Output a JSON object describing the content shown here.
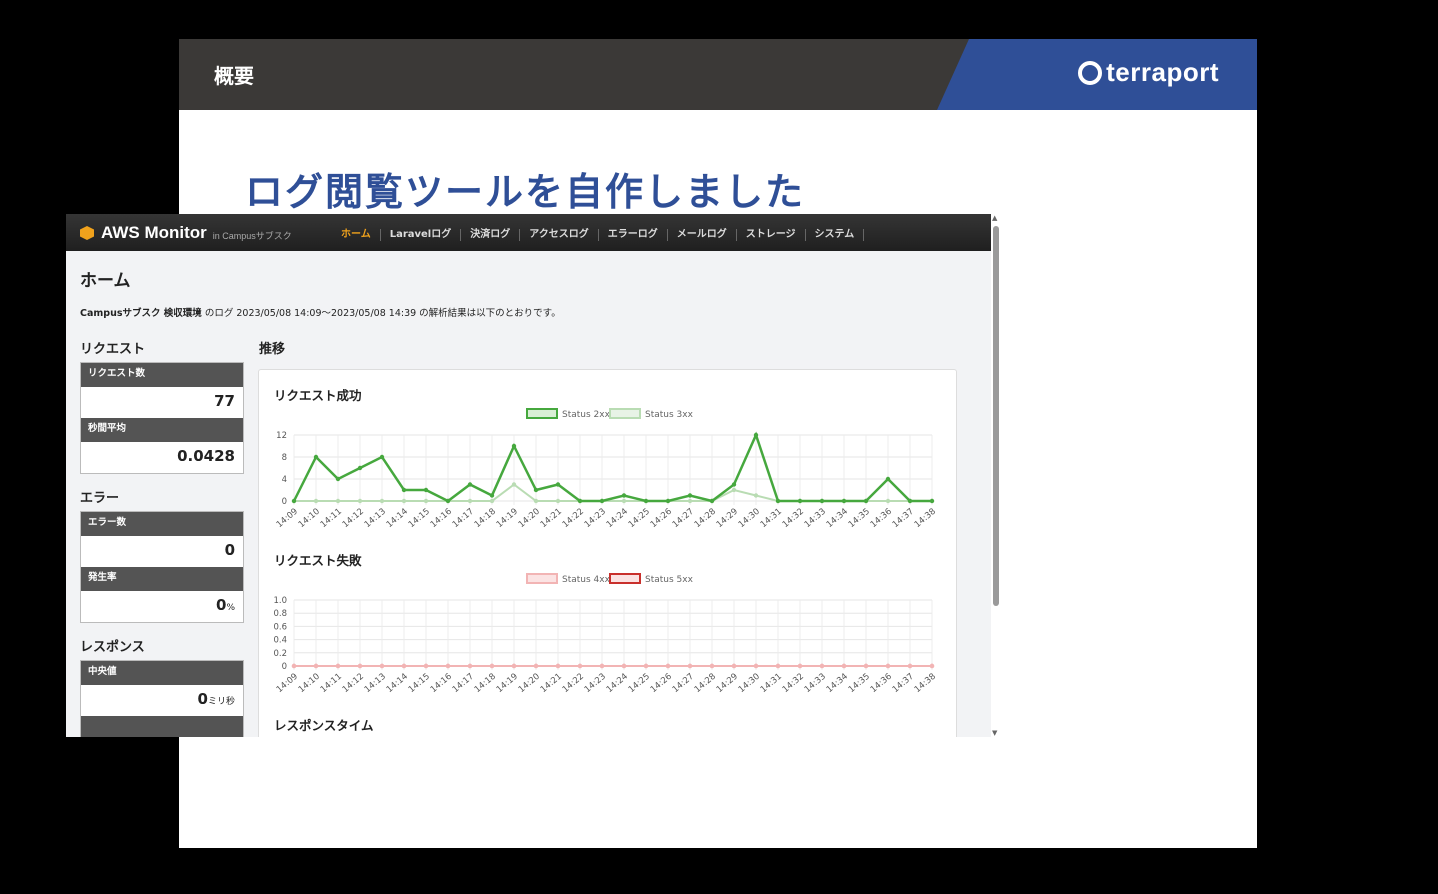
{
  "slide": {
    "section_title": "概要",
    "logo_text": "terraport",
    "headline": "ログ閲覧ツールを自作しました"
  },
  "app": {
    "brand": "AWS Monitor",
    "brand_sub": "in Campusサブスク",
    "nav": [
      "ホーム",
      "Laravelログ",
      "決済ログ",
      "アクセスログ",
      "エラーログ",
      "メールログ",
      "ストレージ",
      "システム"
    ],
    "active_nav": 0,
    "page_title": "ホーム",
    "summary_bold": "Campusサブスク 検収環境",
    "summary_rest": " のログ 2023/05/08 14:09〜2023/05/08 14:39 の解析結果は以下のとおりです。",
    "request": {
      "title": "リクエスト",
      "count_label": "リクエスト数",
      "count": "77",
      "avg_label": "秒間平均",
      "avg": "0.0428"
    },
    "error": {
      "title": "エラー",
      "count_label": "エラー数",
      "count": "0",
      "rate_label": "発生率",
      "rate": "0",
      "rate_unit": "%"
    },
    "response": {
      "title": "レスポンス",
      "median_label": "中央値",
      "median": "0",
      "median_unit": "ミリ秒"
    },
    "trend_title": "推移",
    "chart3_title": "レスポンスタイム"
  },
  "colors": {
    "accent_blue": "#2f4f97",
    "green": "#46a83e",
    "light_green": "#b9dcb3",
    "pink": "#f2b4b4",
    "red": "#c9302c"
  },
  "chart_data": [
    {
      "type": "line",
      "title": "リクエスト成功",
      "categories": [
        "14:09",
        "14:10",
        "14:11",
        "14:12",
        "14:13",
        "14:14",
        "14:15",
        "14:16",
        "14:17",
        "14:18",
        "14:19",
        "14:20",
        "14:21",
        "14:22",
        "14:23",
        "14:24",
        "14:25",
        "14:26",
        "14:27",
        "14:28",
        "14:29",
        "14:30",
        "14:31",
        "14:32",
        "14:33",
        "14:34",
        "14:35",
        "14:36",
        "14:37",
        "14:38"
      ],
      "series": [
        {
          "name": "Status 2xx",
          "values": [
            0,
            8,
            4,
            6,
            8,
            2,
            2,
            0,
            3,
            1,
            10,
            2,
            3,
            0,
            0,
            1,
            0,
            0,
            1,
            0,
            3,
            12,
            0,
            0,
            0,
            0,
            0,
            4,
            0,
            0
          ]
        },
        {
          "name": "Status 3xx",
          "values": [
            0,
            0,
            0,
            0,
            0,
            0,
            0,
            0,
            0,
            0,
            3,
            0,
            0,
            0,
            0,
            0,
            0,
            0,
            0,
            0,
            2,
            1,
            0,
            0,
            0,
            0,
            0,
            0,
            0,
            0
          ]
        }
      ],
      "yticks": [
        0,
        4,
        8,
        12
      ],
      "ylim": [
        0,
        12
      ],
      "grid": true,
      "legend": "top-center"
    },
    {
      "type": "line",
      "title": "リクエスト失敗",
      "categories": [
        "14:09",
        "14:10",
        "14:11",
        "14:12",
        "14:13",
        "14:14",
        "14:15",
        "14:16",
        "14:17",
        "14:18",
        "14:19",
        "14:20",
        "14:21",
        "14:22",
        "14:23",
        "14:24",
        "14:25",
        "14:26",
        "14:27",
        "14:28",
        "14:29",
        "14:30",
        "14:31",
        "14:32",
        "14:33",
        "14:34",
        "14:35",
        "14:36",
        "14:37",
        "14:38"
      ],
      "series": [
        {
          "name": "Status 4xx",
          "values": [
            0,
            0,
            0,
            0,
            0,
            0,
            0,
            0,
            0,
            0,
            0,
            0,
            0,
            0,
            0,
            0,
            0,
            0,
            0,
            0,
            0,
            0,
            0,
            0,
            0,
            0,
            0,
            0,
            0,
            0
          ]
        },
        {
          "name": "Status 5xx",
          "values": [
            0,
            0,
            0,
            0,
            0,
            0,
            0,
            0,
            0,
            0,
            0,
            0,
            0,
            0,
            0,
            0,
            0,
            0,
            0,
            0,
            0,
            0,
            0,
            0,
            0,
            0,
            0,
            0,
            0,
            0
          ]
        }
      ],
      "yticks": [
        "0",
        "0.2",
        "0.4",
        "0.6",
        "0.8",
        "1.0"
      ],
      "ylim": [
        0,
        1.0
      ],
      "grid": true,
      "legend": "top-center"
    }
  ]
}
